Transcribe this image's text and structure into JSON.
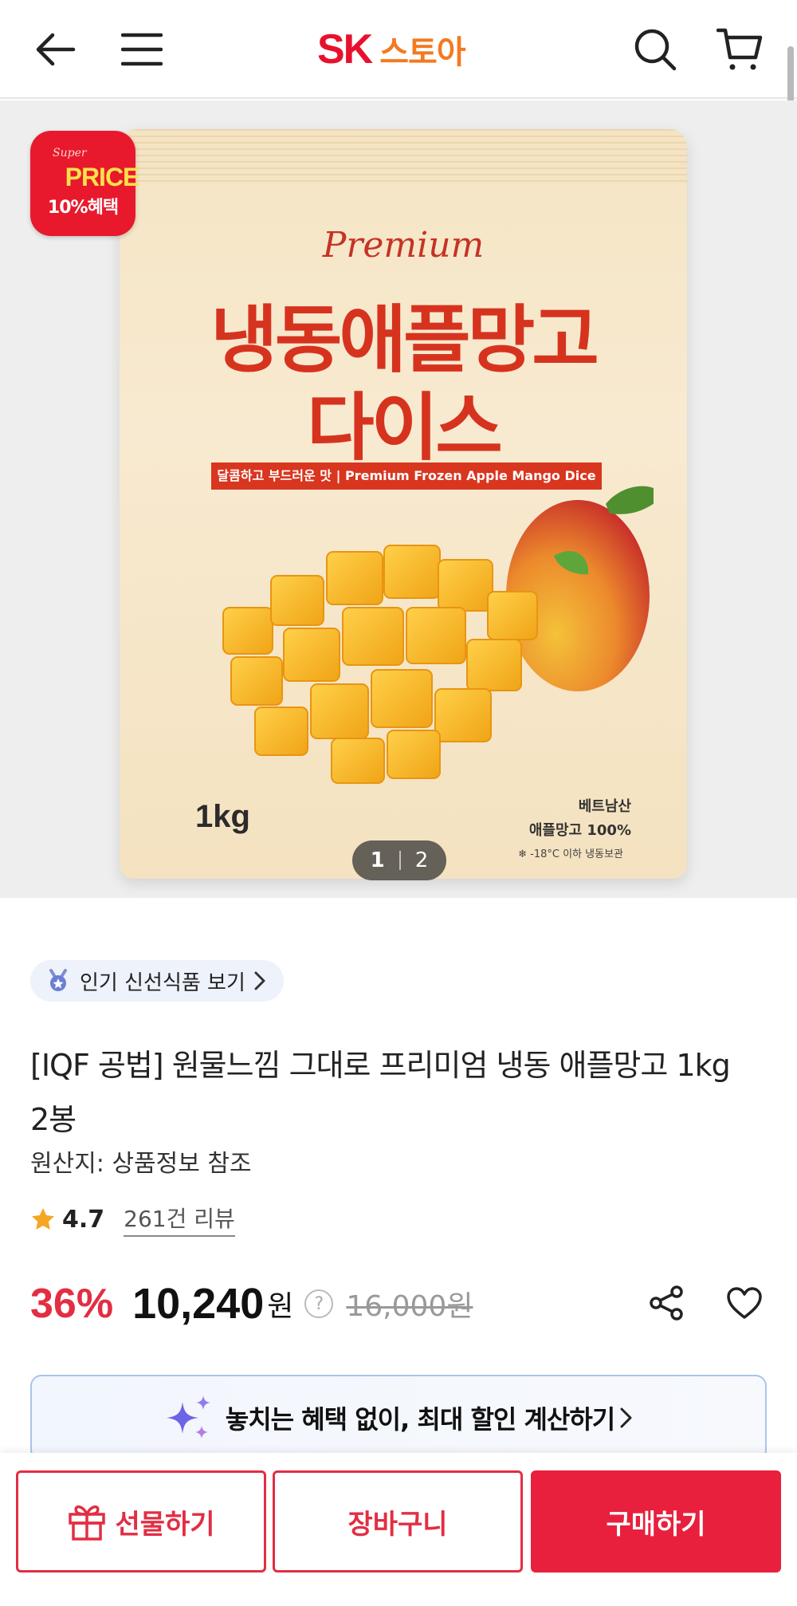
{
  "header": {
    "logo_sk": "SK",
    "logo_store": "스토아"
  },
  "hero": {
    "badge": {
      "super": "Super",
      "price": "PRICE",
      "benefit": "10%혜택"
    },
    "package": {
      "premium": "Premium",
      "title_line1": "냉동애플망고",
      "title_line2": "다이스",
      "tagline": "달콤하고 부드러운 맛 | Premium Frozen Apple Mango Dice",
      "weight": "1kg",
      "origin_line1": "베트남산",
      "origin_line2": "애플망고 100%",
      "storage": "❄ -18°C 이하 냉동보관"
    },
    "pager": {
      "current": "1",
      "total": "2"
    }
  },
  "product": {
    "chip_label": "인기 신선식품 보기",
    "title": "[IQF 공법] 원물느낌 그대로 프리미엄 냉동 애플망고 1kg 2봉",
    "subtitle": "원산지: 상품정보 참조",
    "rating": "4.7",
    "reviews": "261건 리뷰",
    "discount": "36%",
    "price": "10,240",
    "currency": "원",
    "help": "?",
    "original_price": "16,000원"
  },
  "calc_banner": {
    "label": "놓치는 혜택 없이, 최대 할인 계산하기"
  },
  "bottom_bar": {
    "gift_label": "선물하기",
    "cart_label": "장바구니",
    "buy_label": "구매하기"
  },
  "colors": {
    "brand_red": "#e8112d",
    "brand_orange": "#f47920",
    "price_red": "#e22e43",
    "buy_button": "#e8203e"
  }
}
